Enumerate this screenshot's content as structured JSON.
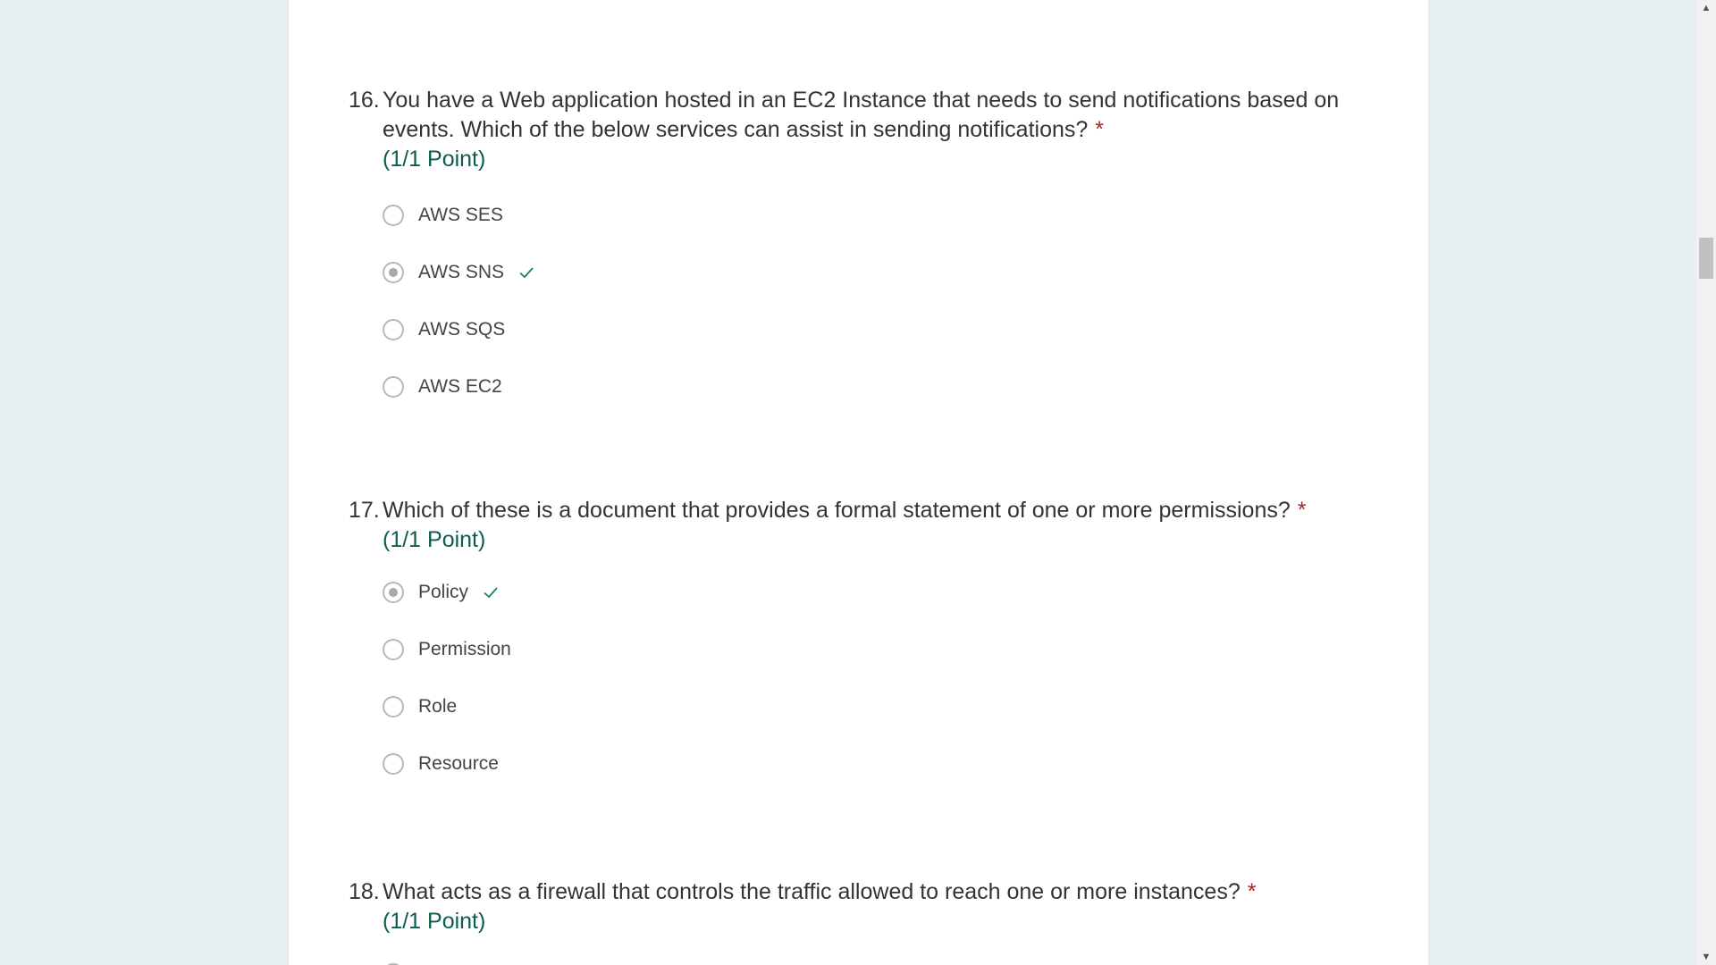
{
  "questions": [
    {
      "number": "16.",
      "text_line1": "You have a Web application hosted in an EC2 Instance that needs to send notifications based on",
      "text_line2": "events. Which of the below services can assist in sending notifications?",
      "required_mark": "*",
      "points": "(1/1 Point)",
      "options": [
        {
          "label": "AWS SES",
          "selected": false,
          "correct": false
        },
        {
          "label": "AWS SNS",
          "selected": true,
          "correct": true
        },
        {
          "label": "AWS SQS",
          "selected": false,
          "correct": false
        },
        {
          "label": "AWS EC2",
          "selected": false,
          "correct": false
        }
      ]
    },
    {
      "number": "17.",
      "text_line1": "Which of these is a document that provides a formal statement of one or more permissions?",
      "required_mark": "*",
      "points": "(1/1 Point)",
      "options": [
        {
          "label": "Policy",
          "selected": true,
          "correct": true
        },
        {
          "label": "Permission",
          "selected": false,
          "correct": false
        },
        {
          "label": "Role",
          "selected": false,
          "correct": false
        },
        {
          "label": "Resource",
          "selected": false,
          "correct": false
        }
      ]
    },
    {
      "number": "18.",
      "text_line1": "What acts as a firewall that controls the traffic allowed to reach one or more instances?",
      "required_mark": "*",
      "points": "(1/1 Point)"
    }
  ],
  "icons": {
    "checkmark": "checkmark-icon",
    "scroll_up": "▲",
    "scroll_down": "▼"
  },
  "colors": {
    "accent_green": "#0d5c4f",
    "required_red": "#a4262c",
    "page_background": "#e8eff1"
  }
}
